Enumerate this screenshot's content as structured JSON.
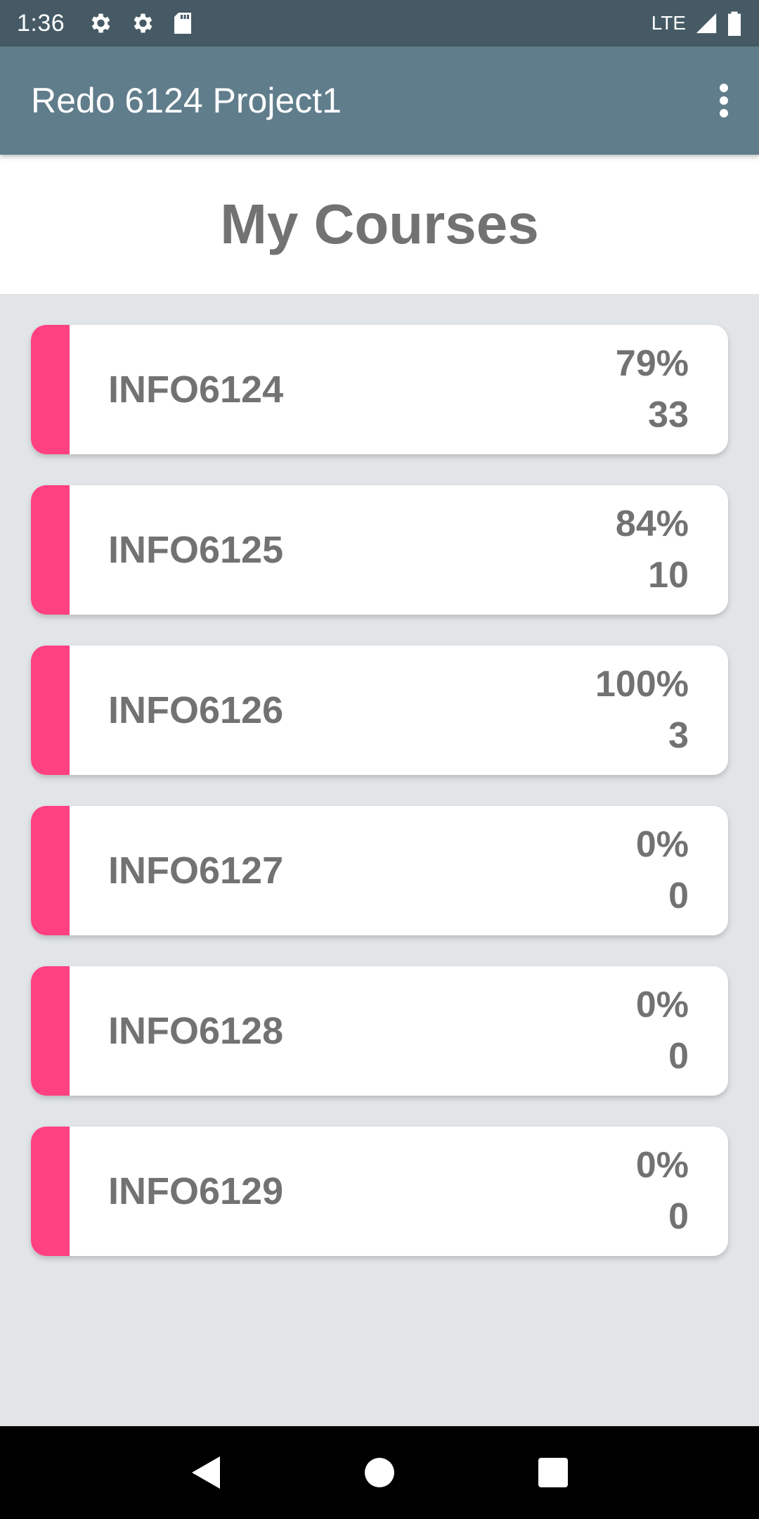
{
  "status_bar": {
    "time": "1:36",
    "network": "LTE",
    "icons_left": [
      "gear-icon",
      "gear-icon",
      "sd-card-icon"
    ],
    "icons_right": [
      "signal-icon",
      "battery-icon"
    ]
  },
  "app_bar": {
    "title": "Redo 6124 Project1",
    "menu_icon": "overflow-menu-icon"
  },
  "page": {
    "title": "My Courses"
  },
  "courses": [
    {
      "code": "INFO6124",
      "percent": "79%",
      "count": "33"
    },
    {
      "code": "INFO6125",
      "percent": "84%",
      "count": "10"
    },
    {
      "code": "INFO6126",
      "percent": "100%",
      "count": "3"
    },
    {
      "code": "INFO6127",
      "percent": "0%",
      "count": "0"
    },
    {
      "code": "INFO6128",
      "percent": "0%",
      "count": "0"
    },
    {
      "code": "INFO6129",
      "percent": "0%",
      "count": "0"
    }
  ],
  "colors": {
    "status_bar": "#455a64",
    "app_bar": "#607d8b",
    "accent": "#ff4081",
    "text_gray": "#727272",
    "background": "#e1e5e8"
  },
  "nav_bar": {
    "buttons": [
      "back-icon",
      "home-icon",
      "recents-icon"
    ]
  }
}
